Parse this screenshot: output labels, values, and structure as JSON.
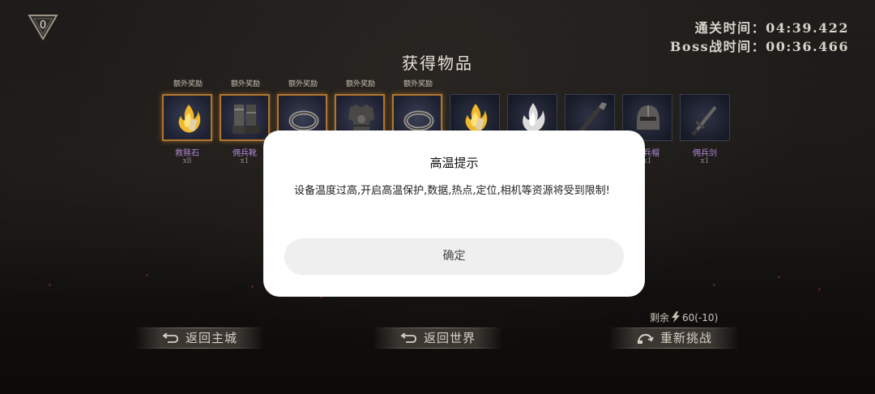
{
  "rank": {
    "value": "0"
  },
  "timers": {
    "clear_time": "通关时间：04:39.422",
    "boss_time": "Boss战时间：00:36.466"
  },
  "items_title": "获得物品",
  "items": [
    {
      "bonus": "额外奖励",
      "name": "救赎石",
      "qty": "x8",
      "icon": "flame-crystal-icon"
    },
    {
      "bonus": "额外奖励",
      "name": "佣兵靴",
      "qty": "x1",
      "icon": "boots-icon"
    },
    {
      "bonus": "额外奖励",
      "name": "",
      "qty": "",
      "icon": "ring-icon"
    },
    {
      "bonus": "额外奖励",
      "name": "",
      "qty": "",
      "icon": "armor-icon"
    },
    {
      "bonus": "额外奖励",
      "name": "",
      "qty": "",
      "icon": "ring-icon"
    },
    {
      "bonus": "",
      "name": "",
      "qty": "",
      "icon": "flame-crystal-icon"
    },
    {
      "bonus": "",
      "name": "",
      "qty": "",
      "icon": "white-crystal-icon"
    },
    {
      "bonus": "",
      "name": "",
      "qty": "",
      "icon": "spear-icon"
    },
    {
      "bonus": "",
      "name": "佣兵帽",
      "qty": "x1",
      "icon": "helmet-icon"
    },
    {
      "bonus": "",
      "name": "佣兵剑",
      "qty": "x1",
      "icon": "sword-icon"
    }
  ],
  "dialog": {
    "title": "高温提示",
    "message": "设备温度过高,开启高温保护,数据,热点,定位,相机等资源将受到限制!",
    "confirm": "确定"
  },
  "stamina": {
    "label": "剩余",
    "value": "60(-10)",
    "icon": "lightning-icon"
  },
  "buttons": {
    "back_to_city": "返回主城",
    "back_to_world": "返回世界",
    "retry": "重新挑战"
  },
  "colors": {
    "bonus_border": "#b3762e",
    "item_name": "#b18ad8",
    "dialog_bg": "#ffffff"
  }
}
